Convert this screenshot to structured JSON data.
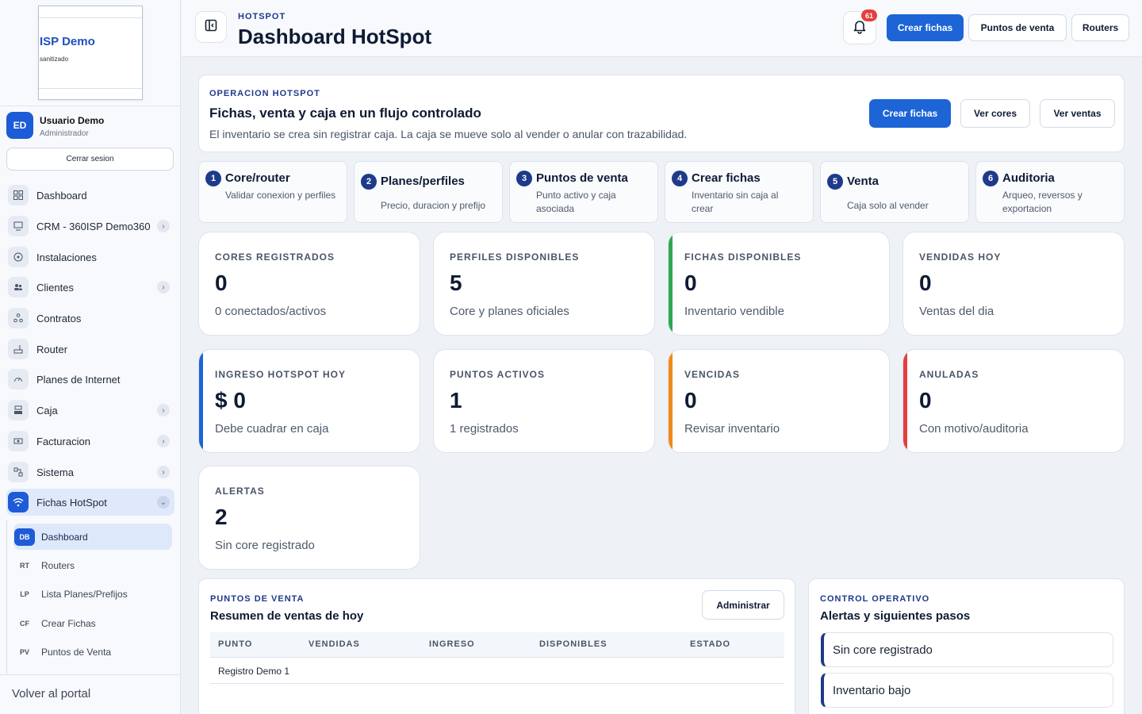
{
  "sidebar": {
    "logo": {
      "name": "ISP Demo",
      "sub": "sanitizado"
    },
    "user": {
      "initials": "ED",
      "name": "Usuario Demo",
      "role": "Administrador"
    },
    "logout_label": "Cerrar sesion",
    "items": [
      {
        "label": "Dashboard",
        "icon": "dashboard-icon",
        "chevron": false
      },
      {
        "label": "CRM - 360ISP Demo360",
        "icon": "crm-icon",
        "chevron": true
      },
      {
        "label": "Instalaciones",
        "icon": "installations-icon",
        "chevron": false
      },
      {
        "label": "Clientes",
        "icon": "clients-icon",
        "chevron": true
      },
      {
        "label": "Contratos",
        "icon": "contracts-icon",
        "chevron": false
      },
      {
        "label": "Router",
        "icon": "router-icon",
        "chevron": false
      },
      {
        "label": "Planes de Internet",
        "icon": "speed-icon",
        "chevron": false
      },
      {
        "label": "Caja",
        "icon": "cash-icon",
        "chevron": true
      },
      {
        "label": "Facturacion",
        "icon": "billing-icon",
        "chevron": true
      },
      {
        "label": "Sistema",
        "icon": "system-icon",
        "chevron": true
      },
      {
        "label": "Fichas HotSpot",
        "icon": "wifi-icon",
        "chevron": true
      }
    ],
    "subitems": [
      {
        "code": "DB",
        "label": "Dashboard"
      },
      {
        "code": "RT",
        "label": "Routers"
      },
      {
        "code": "LP",
        "label": "Lista Planes/Prefijos"
      },
      {
        "code": "CF",
        "label": "Crear Fichas"
      },
      {
        "code": "PV",
        "label": "Puntos de Venta"
      }
    ],
    "back_label": "Volver al portal"
  },
  "header": {
    "kicker": "HOTSPOT",
    "title": "Dashboard HotSpot",
    "notifications": "61",
    "buttons": {
      "create": "Crear fichas",
      "points": "Puntos de venta",
      "routers": "Routers"
    }
  },
  "operation": {
    "kicker": "OPERACION HOTSPOT",
    "title": "Fichas, venta y caja en un flujo controlado",
    "desc": "El inventario se crea sin registrar caja. La caja se mueve solo al vender o anular con trazabilidad.",
    "buttons": {
      "create": "Crear fichas",
      "cores": "Ver cores",
      "sales": "Ver ventas"
    }
  },
  "steps": [
    {
      "num": "1",
      "title": "Core/router",
      "desc": "Validar conexion y perfiles"
    },
    {
      "num": "2",
      "title": "Planes/perfiles",
      "desc": "Precio, duracion y prefijo"
    },
    {
      "num": "3",
      "title": "Puntos de venta",
      "desc": "Punto activo y caja asociada"
    },
    {
      "num": "4",
      "title": "Crear fichas",
      "desc": "Inventario sin caja al crear"
    },
    {
      "num": "5",
      "title": "Venta",
      "desc": "Caja solo al vender"
    },
    {
      "num": "6",
      "title": "Auditoria",
      "desc": "Arqueo, reversos y exportacion"
    }
  ],
  "stats": [
    {
      "label": "CORES REGISTRADOS",
      "value": "0",
      "sub": "0 conectados/activos",
      "accent": "#e2e7ef"
    },
    {
      "label": "PERFILES DISPONIBLES",
      "value": "5",
      "sub": "Core y planes oficiales",
      "accent": "#e2e7ef"
    },
    {
      "label": "FICHAS DISPONIBLES",
      "value": "0",
      "sub": "Inventario vendible",
      "accent": "#2fa84f"
    },
    {
      "label": "VENDIDAS HOY",
      "value": "0",
      "sub": "Ventas del dia",
      "accent": "#e2e7ef"
    },
    {
      "label": "INGRESO HOTSPOT HOY",
      "value": "$ 0",
      "sub": "Debe cuadrar en caja",
      "accent": "#1d64d6"
    },
    {
      "label": "PUNTOS ACTIVOS",
      "value": "1",
      "sub": "1 registrados",
      "accent": "#e2e7ef"
    },
    {
      "label": "VENCIDAS",
      "value": "0",
      "sub": "Revisar inventario",
      "accent": "#f28a1a"
    },
    {
      "label": "ANULADAS",
      "value": "0",
      "sub": "Con motivo/auditoria",
      "accent": "#e53e3e"
    },
    {
      "label": "ALERTAS",
      "value": "2",
      "sub": "Sin core registrado",
      "accent": "#e2e7ef"
    }
  ],
  "points_of_sale": {
    "kicker": "PUNTOS DE VENTA",
    "title": "Resumen de ventas de hoy",
    "admin_label": "Administrar",
    "columns": [
      "PUNTO",
      "VENDIDAS",
      "INGRESO",
      "DISPONIBLES",
      "ESTADO"
    ],
    "rows": [
      [
        "Registro Demo 1",
        "",
        "",
        "",
        ""
      ]
    ]
  },
  "control": {
    "kicker": "CONTROL OPERATIVO",
    "title": "Alertas y siguientes pasos",
    "alerts": [
      "Sin core registrado",
      "Inventario bajo"
    ]
  }
}
